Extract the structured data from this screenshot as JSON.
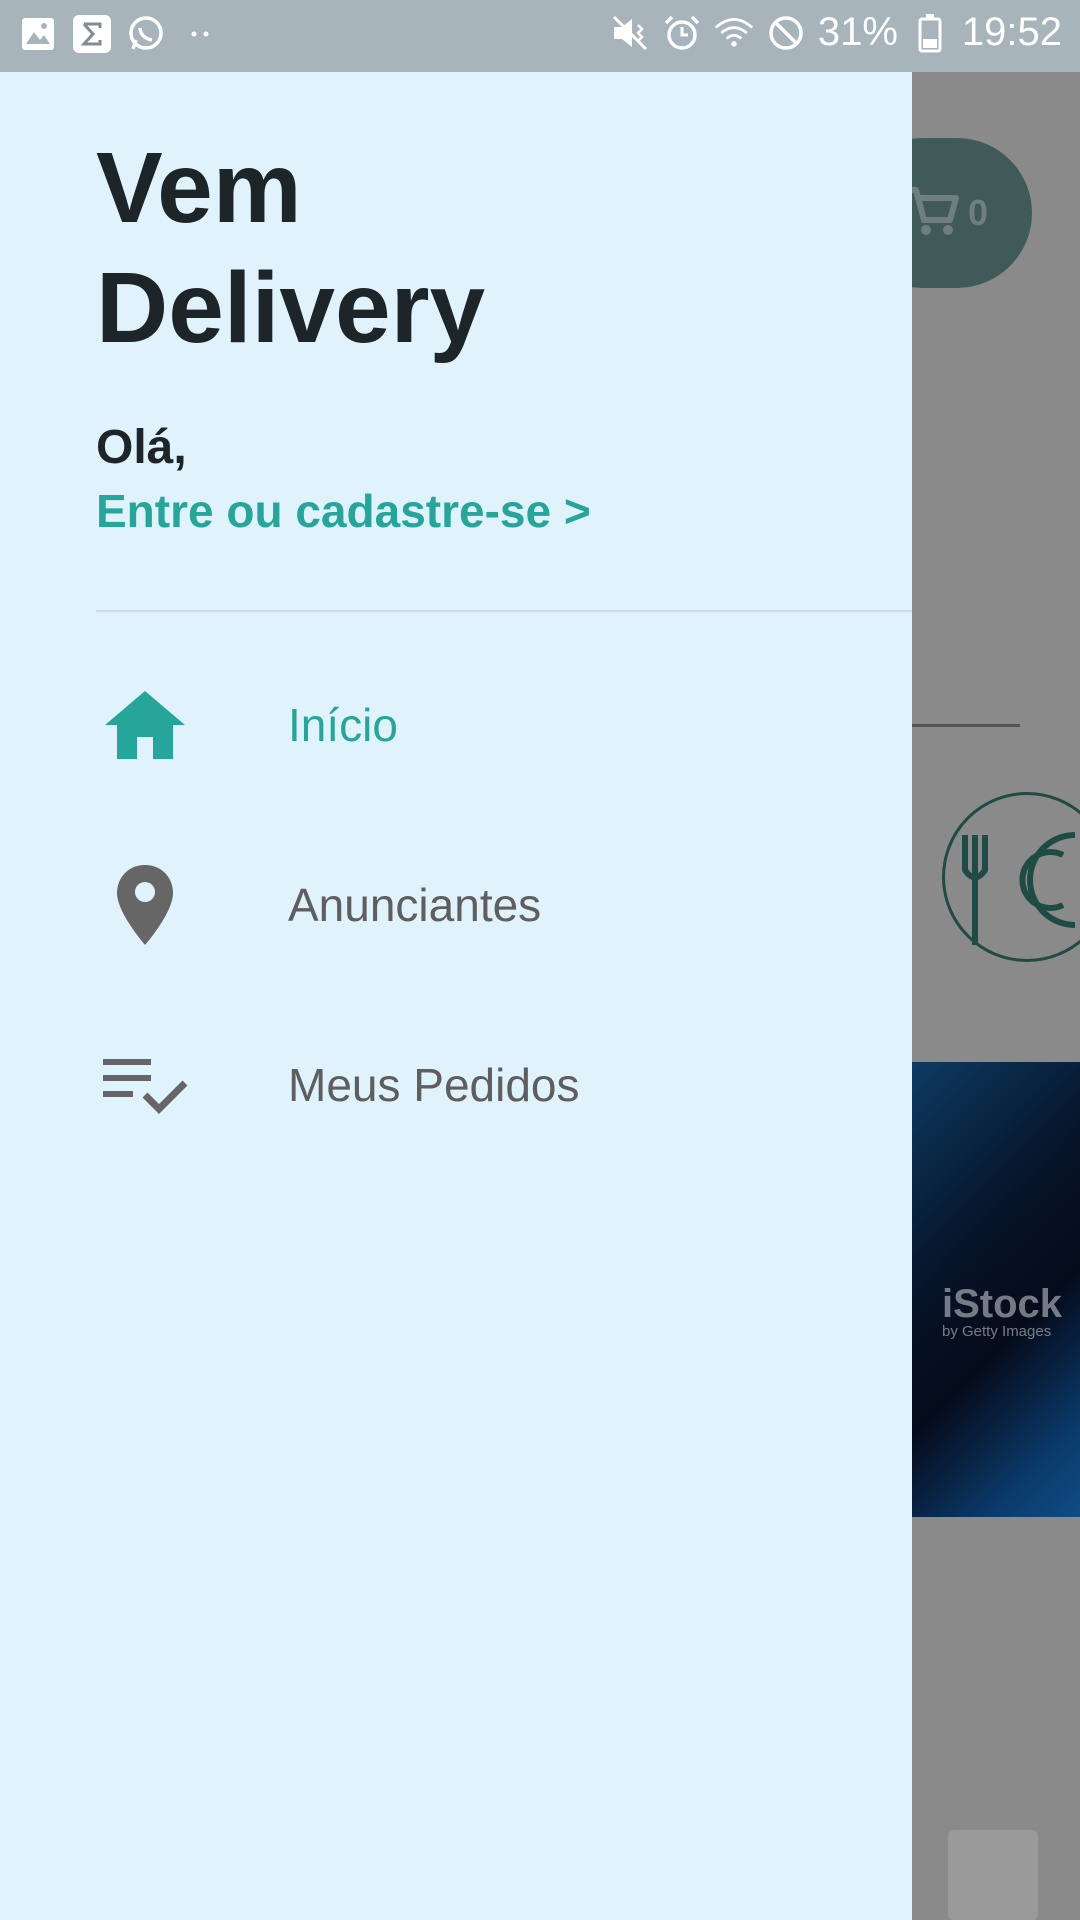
{
  "status_bar": {
    "battery_percent": "31%",
    "time": "19:52",
    "icons": [
      "gallery-icon",
      "sigma-app-icon",
      "whatsapp-icon",
      "more-notifications-icon",
      "mute-vibrate-icon",
      "alarm-icon",
      "wifi-icon",
      "do-not-disturb-icon",
      "battery-icon"
    ]
  },
  "drawer": {
    "app_title": "Vem Delivery",
    "greeting": "Olá,",
    "login_link": "Entre ou cadastre-se >",
    "nav_items": [
      {
        "label": "Início",
        "icon": "home-icon",
        "active": true
      },
      {
        "label": "Anunciantes",
        "icon": "location-pin-icon",
        "active": false
      },
      {
        "label": "Meus Pedidos",
        "icon": "checklist-icon",
        "active": false
      }
    ]
  },
  "background": {
    "cart_count": "0",
    "banner_watermark": "iStock",
    "banner_watermark_sub": "by Getty Images"
  },
  "colors": {
    "accent": "#26a69a",
    "drawer_bg": "#e0f3fc",
    "title_text": "#1e2528",
    "nav_text": "#5e5e5e",
    "status_bar": "#a7b4bb"
  }
}
